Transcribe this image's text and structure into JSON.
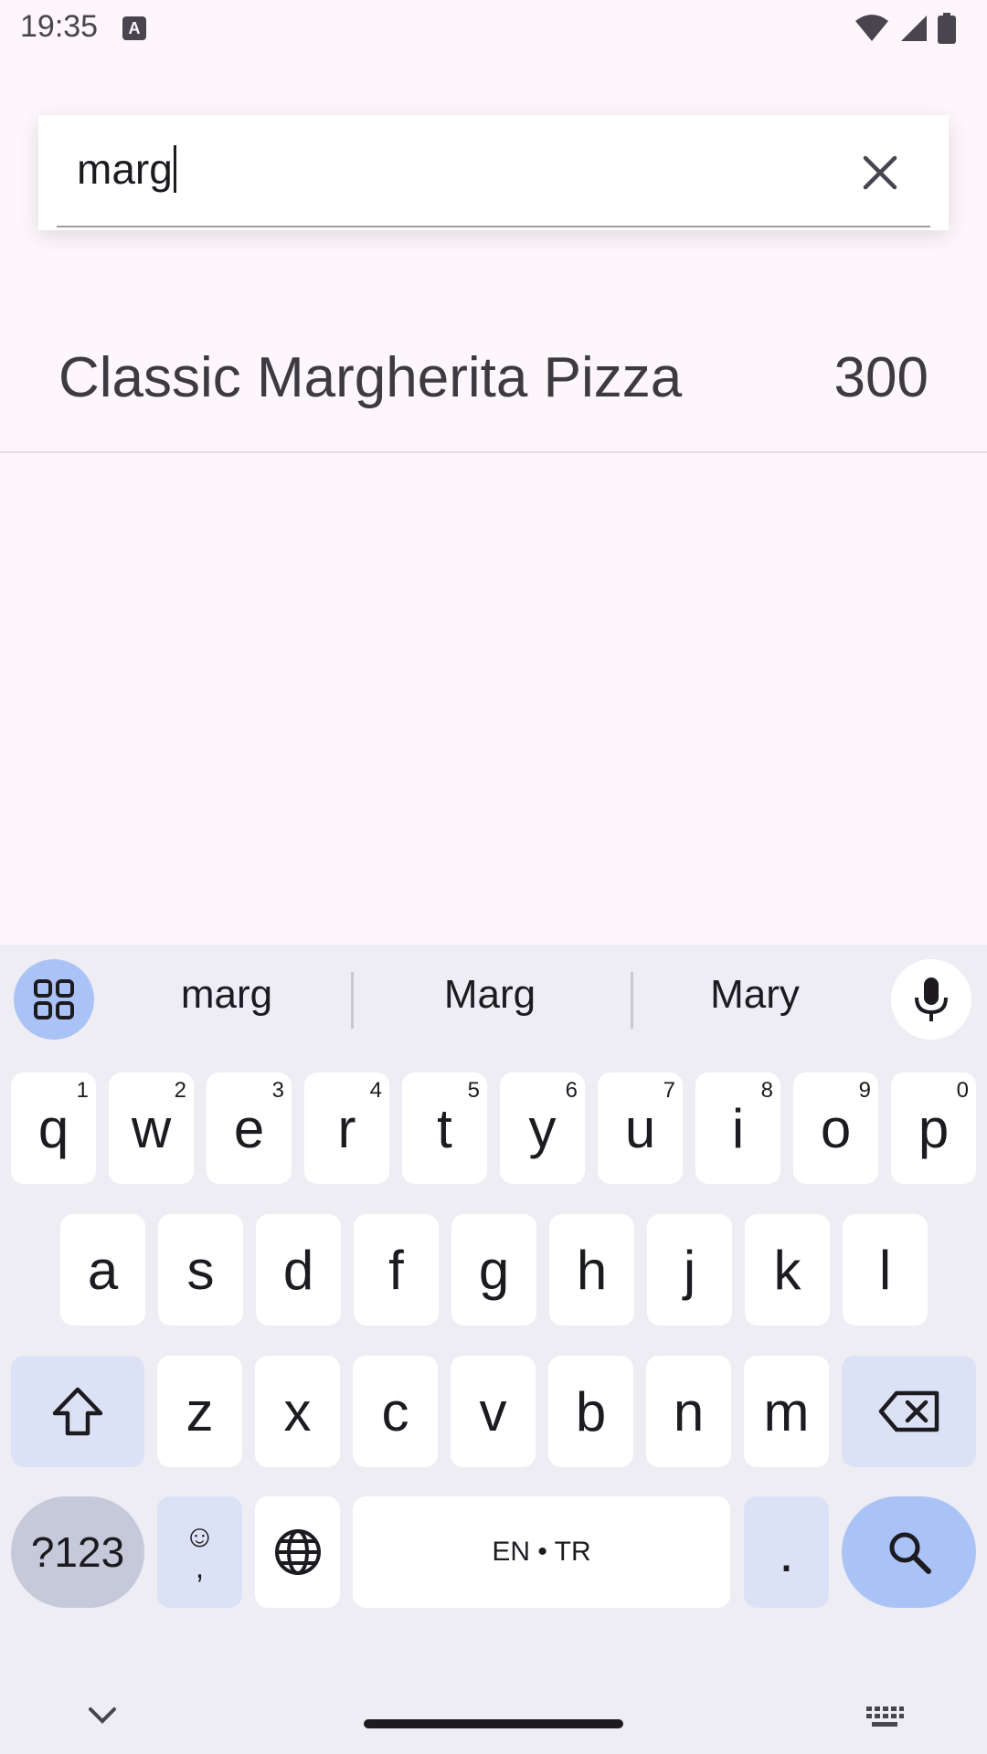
{
  "status": {
    "time": "19:35",
    "indicator": "A"
  },
  "search": {
    "value": "marg",
    "clear_icon": "close-icon"
  },
  "results": [
    {
      "name": "Classic Margherita Pizza",
      "value": "300"
    }
  ],
  "keyboard": {
    "suggestions": [
      "marg",
      "Marg",
      "Mary"
    ],
    "row1": [
      {
        "k": "q",
        "h": "1"
      },
      {
        "k": "w",
        "h": "2"
      },
      {
        "k": "e",
        "h": "3"
      },
      {
        "k": "r",
        "h": "4"
      },
      {
        "k": "t",
        "h": "5"
      },
      {
        "k": "y",
        "h": "6"
      },
      {
        "k": "u",
        "h": "7"
      },
      {
        "k": "i",
        "h": "8"
      },
      {
        "k": "o",
        "h": "9"
      },
      {
        "k": "p",
        "h": "0"
      }
    ],
    "row2": [
      "a",
      "s",
      "d",
      "f",
      "g",
      "h",
      "j",
      "k",
      "l"
    ],
    "row3": [
      "z",
      "x",
      "c",
      "v",
      "b",
      "n",
      "m"
    ],
    "num_label": "?123",
    "emoji_top": "☺",
    "emoji_bottom": ",",
    "space_label": "EN • TR",
    "period_label": "."
  },
  "colors": {
    "background": "#fdf7fb",
    "accent": "#aac2f5",
    "keyboard_bg": "#efedf4"
  }
}
